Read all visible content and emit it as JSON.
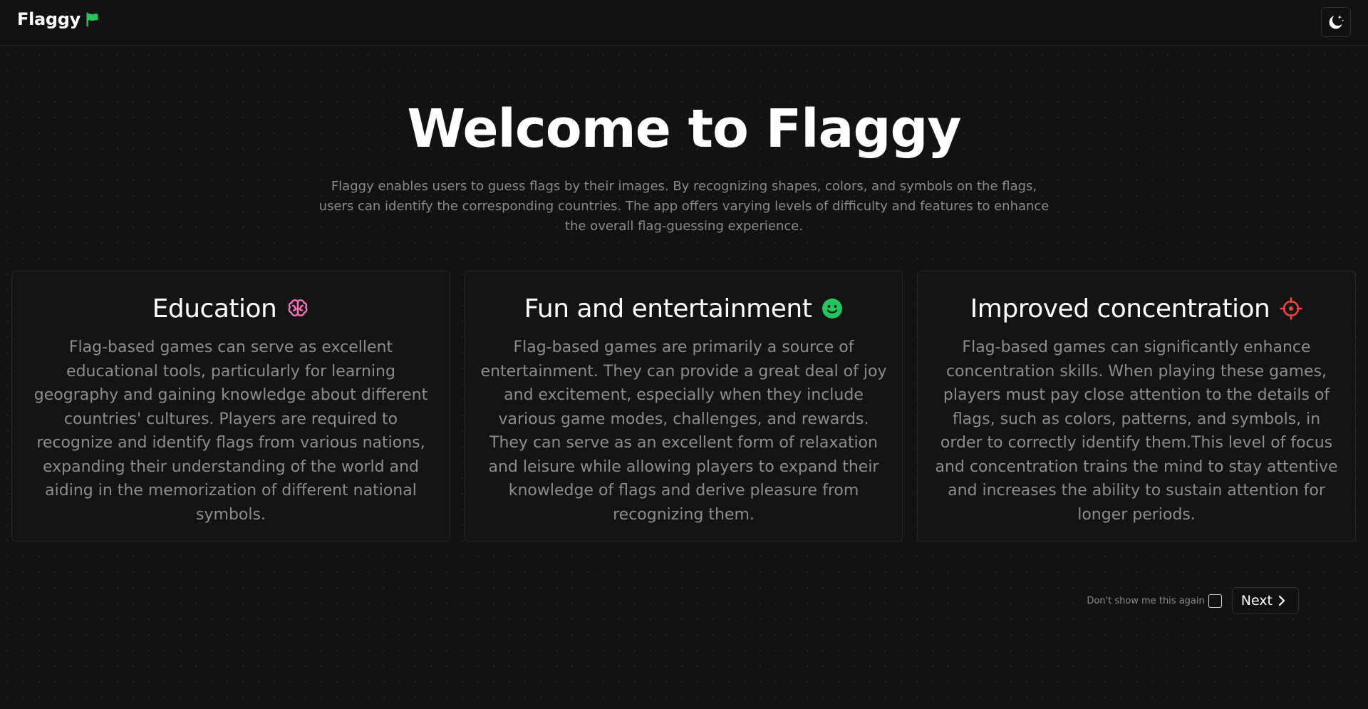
{
  "header": {
    "app_name": "Flaggy",
    "logo_icon": "flag-icon",
    "theme_toggle_icon": "moon-icon"
  },
  "hero": {
    "title": "Welcome to Flaggy",
    "description": "Flaggy enables users to guess flags by their images. By recognizing shapes, colors, and symbols on the flags, users can identify the corresponding countries. The app offers varying levels of difficulty and features to enhance the overall flag-guessing experience."
  },
  "cards": [
    {
      "title": "Education",
      "icon": "brain-icon",
      "icon_color": "#f472b6",
      "body": "Flag-based games can serve as excellent educational tools, particularly for learning geography and gaining knowledge about different countries' cultures. Players are required to recognize and identify flags from various nations, expanding their understanding of the world and aiding in the memorization of different national symbols."
    },
    {
      "title": "Fun and entertainment",
      "icon": "smile-icon",
      "icon_color": "#22c55e",
      "body": "Flag-based games are primarily a source of entertainment. They can provide a great deal of joy and excitement, especially when they include various game modes, challenges, and rewards. They can serve as an excellent form of relaxation and leisure while allowing players to expand their knowledge of flags and derive pleasure from recognizing them."
    },
    {
      "title": "Improved concentration",
      "icon": "target-icon",
      "icon_color": "#ef4444",
      "body": "Flag-based games can significantly enhance concentration skills. When playing these games, players must pay close attention to the details of flags, such as colors, patterns, and symbols, in order to correctly identify them.This level of focus and concentration trains the mind to stay attentive and increases the ability to sustain attention for longer periods."
    }
  ],
  "footer": {
    "dont_show_label": "Don't show me this again",
    "dont_show_checked": false,
    "next_label": "Next"
  },
  "colors": {
    "background": "#121212",
    "accent_green": "#22c55e",
    "text_muted": "#8c8c8c"
  }
}
